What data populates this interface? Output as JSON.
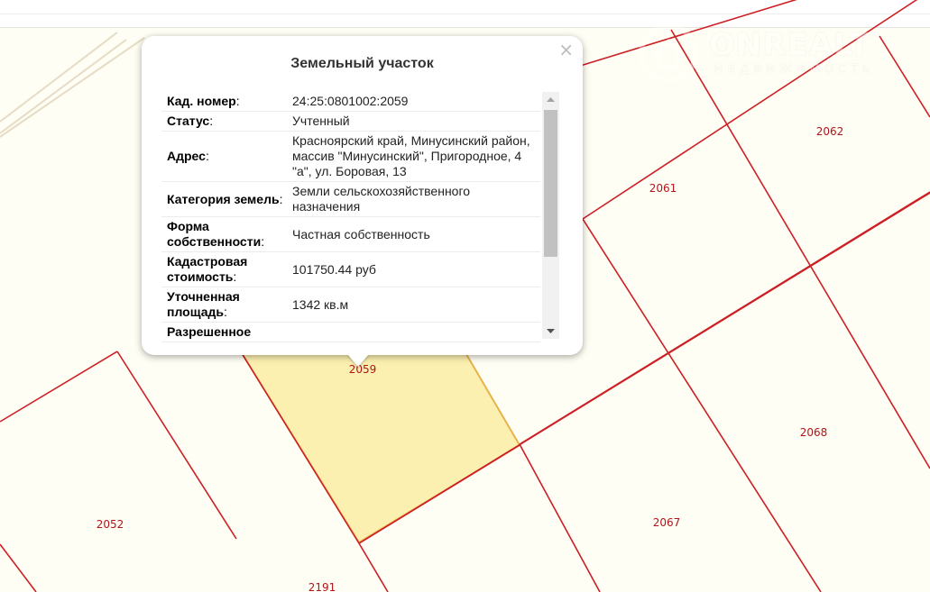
{
  "watermark": {
    "brand": "ONREALT",
    "tagline": "НЕДВИЖИМОСТЬ"
  },
  "map": {
    "colors": {
      "background": "#fffef4",
      "boundary": "#cc1f26",
      "selected_fill": "#fcf0b0",
      "selected_border": "#e8b24a",
      "label": "#b3141c"
    },
    "plots": [
      {
        "id": "2059",
        "label": "2059",
        "selected": true
      },
      {
        "id": "2061",
        "label": "2061"
      },
      {
        "id": "2062",
        "label": "2062"
      },
      {
        "id": "2068",
        "label": "2068"
      },
      {
        "id": "2067",
        "label": "2067"
      },
      {
        "id": "2052",
        "label": "2052"
      },
      {
        "id": "2191",
        "label": "2191"
      }
    ]
  },
  "popup": {
    "title": "Земельный участок",
    "close_label": "×",
    "rows": [
      {
        "key": "Кад. номер",
        "colon": ":",
        "value": "24:25:0801002:2059"
      },
      {
        "key": "Статус",
        "colon": ":",
        "value": "Учтенный"
      },
      {
        "key": "Адрес",
        "colon": ":",
        "value": "Красноярский край, Минусинский район, массив \"Минусинский\", Пригородное, 4 \"а\", ул. Боровая, 13"
      },
      {
        "key": "Категория земель",
        "colon": ":",
        "value": "Земли сельскохозяйственного назначения"
      },
      {
        "key": "Форма собственности",
        "colon": ":",
        "value": "Частная собственность"
      },
      {
        "key": "Кадастровая стоимость",
        "colon": ":",
        "value": "101750.44 руб"
      },
      {
        "key": "Уточненная площадь",
        "colon": ":",
        "value": "1342 кв.м"
      },
      {
        "key": "Разрешенное",
        "colon": "",
        "value": ""
      }
    ]
  }
}
